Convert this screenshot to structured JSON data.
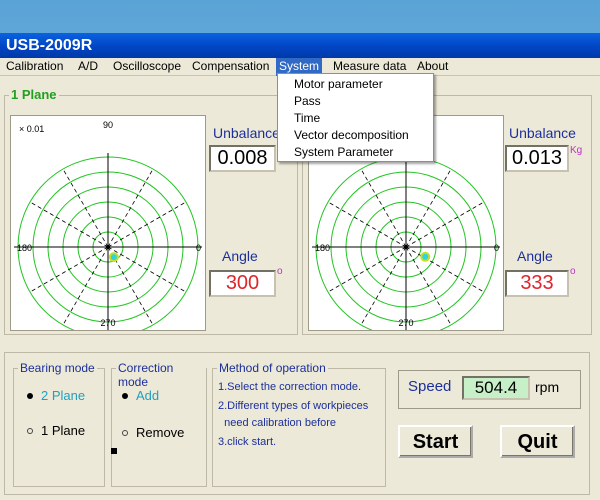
{
  "app": {
    "title": "USB-2009R"
  },
  "menu": {
    "items": [
      "Calibration",
      "A/D",
      "Oscilloscope",
      "Compensation",
      "System",
      "Measure data",
      "About"
    ],
    "active": "System"
  },
  "dropdown": {
    "items": [
      "Motor parameter",
      "Pass",
      "Time",
      "Vector decomposition",
      "System Parameter"
    ]
  },
  "plane1": {
    "label": "1 Plane",
    "plot": {
      "scale": "× 0.01",
      "tick_top": "90",
      "tick_left": "180",
      "tick_right": "0",
      "tick_bottom": "270",
      "angle_deg": 300
    },
    "unbalance_label": "Unbalance",
    "unbalance_value": "0.008",
    "angle_label": "Angle",
    "angle_value": "300",
    "angle_unit": "o"
  },
  "plane2": {
    "plot": {
      "tick_top": "90",
      "tick_left": "180",
      "tick_right": "0",
      "tick_bottom": "270",
      "angle_deg": 333
    },
    "unbalance_label": "Unbalance",
    "unbalance_value": "0.013",
    "unbalance_unit": "Kg",
    "angle_label": "Angle",
    "angle_value": "333",
    "angle_unit": "o"
  },
  "bearing": {
    "label": "Bearing mode",
    "option_2": "2 Plane",
    "option_1": "1  Plane",
    "selected": "2 Plane"
  },
  "correction": {
    "label": "Correction mode",
    "option_add": "Add",
    "option_remove": "Remove",
    "selected": "Add"
  },
  "method": {
    "label": "Method of operation",
    "lines": [
      "1.Select the correction mode.",
      "2.Different types of workpieces",
      "  need calibration before",
      "3.click start."
    ]
  },
  "speed": {
    "label": "Speed",
    "value": "504.4",
    "unit": "rpm"
  },
  "buttons": {
    "start": "Start",
    "quit": "Quit"
  },
  "colors": {
    "title_bar": "#0145c4",
    "plot_rings": "#22c522",
    "marker": "#30d2e6",
    "value_red": "#e0242c",
    "label_blue": "#1c2f9a",
    "plane_label_green": "#20a020"
  }
}
